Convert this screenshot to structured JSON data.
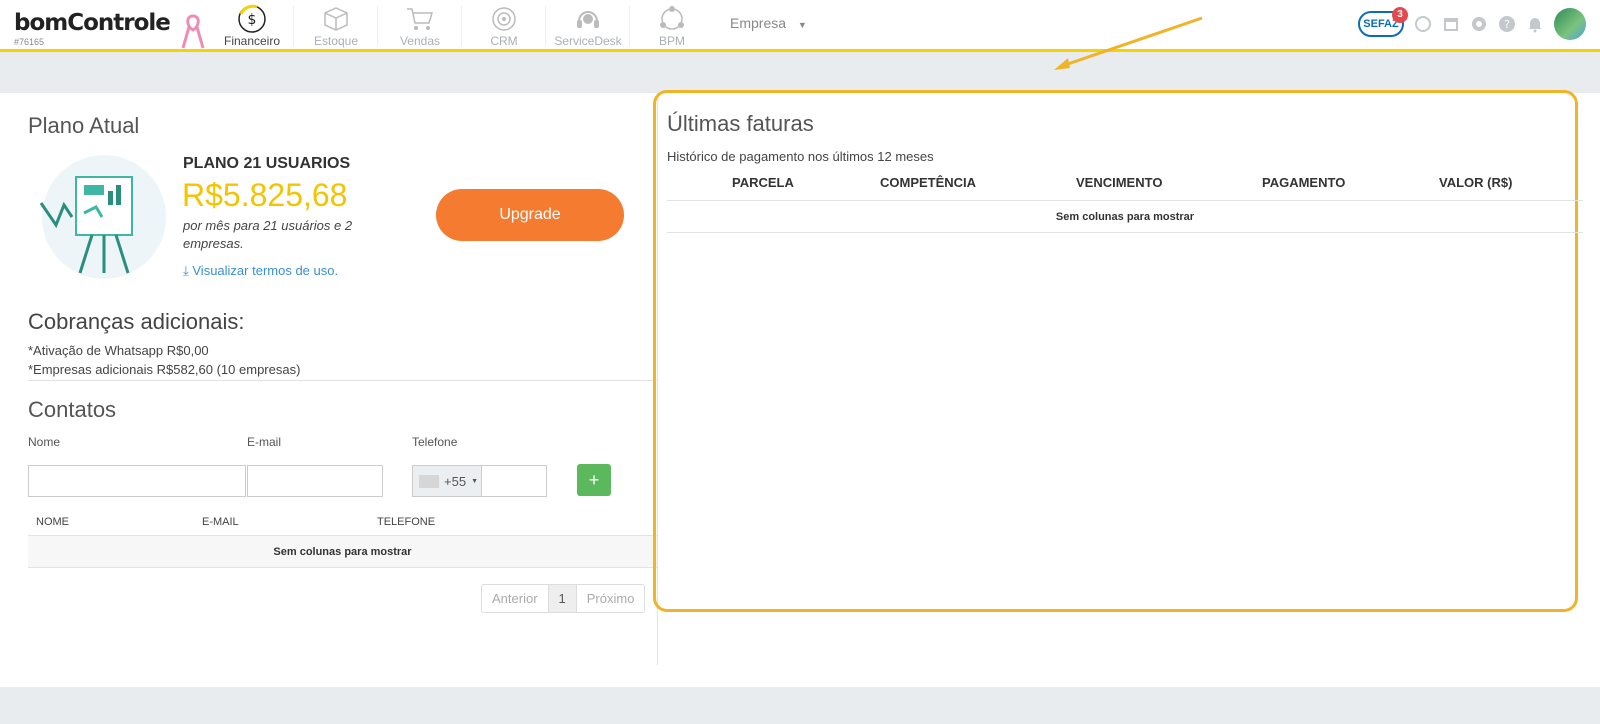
{
  "header": {
    "logo": "bomControle",
    "account_id": "#76165",
    "nav": [
      {
        "label": "Financeiro",
        "icon": "dollar-icon",
        "active": true
      },
      {
        "label": "Estoque",
        "icon": "box-icon"
      },
      {
        "label": "Vendas",
        "icon": "cart-icon"
      },
      {
        "label": "CRM",
        "icon": "target-icon"
      },
      {
        "label": "ServiceDesk",
        "icon": "headset-icon"
      },
      {
        "label": "BPM",
        "icon": "bpm-icon"
      }
    ],
    "empresa_label": "Empresa",
    "sefaz_label": "SEFAZ",
    "sefaz_badge": "3"
  },
  "plano": {
    "title": "Plano Atual",
    "name": "PLANO 21 USUARIOS",
    "price": "R$5.825,68",
    "description": "por mês para 21 usuários e 2 empresas.",
    "terms_link": "Visualizar termos de uso.",
    "upgrade_label": "Upgrade"
  },
  "cobrancas": {
    "title": "Cobranças adicionais:",
    "items": [
      "*Ativação de Whatsapp R$0,00",
      "*Empresas adicionais R$582,60 (10 empresas)"
    ]
  },
  "contatos": {
    "title": "Contatos",
    "nome_label": "Nome",
    "email_label": "E-mail",
    "telefone_label": "Telefone",
    "phone_prefix": "+55",
    "add_label": "+",
    "columns": [
      "NOME",
      "E-MAIL",
      "TELEFONE"
    ],
    "empty_text": "Sem colunas para mostrar",
    "pager": {
      "prev": "Anterior",
      "current": "1",
      "next": "Próximo"
    }
  },
  "faturas": {
    "title": "Últimas faturas",
    "subtitle": "Histórico de pagamento nos últimos 12 meses",
    "columns": [
      "PARCELA",
      "COMPETÊNCIA",
      "VENCIMENTO",
      "PAGAMENTO",
      "VALOR (R$)"
    ],
    "empty_text": "Sem colunas para mostrar"
  },
  "colors": {
    "accent": "#f5d200",
    "upgrade": "#f47b30",
    "price": "#f5c400",
    "highlight": "#f0b429",
    "add": "#5cb85c"
  }
}
